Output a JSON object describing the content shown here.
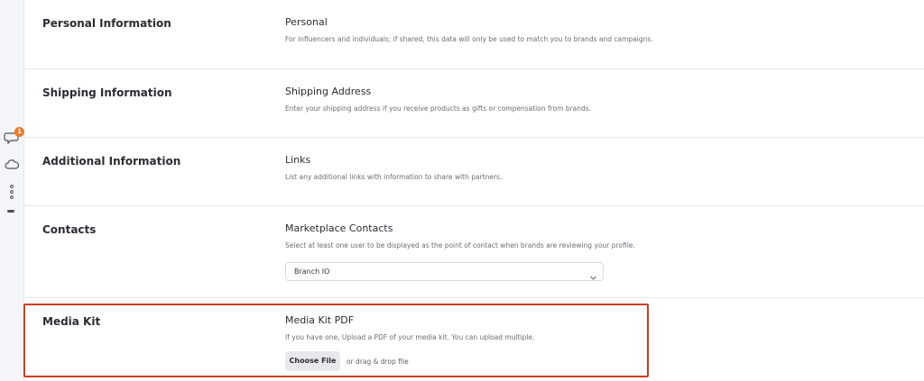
{
  "rail": {
    "icons": [
      "chat-bubble-icon",
      "cloud-icon",
      "more-dots-icon"
    ],
    "notification_count": "1",
    "badge_color": "#e87a2a"
  },
  "sections": [
    {
      "title": "Personal Information",
      "field_title": "Personal",
      "description": "For influencers and individuals; if shared, this data will only be used to match you to brands and campaigns."
    },
    {
      "title": "Shipping Information",
      "field_title": "Shipping Address",
      "description": "Enter your shipping address if you receive products as gifts or compensation from brands."
    },
    {
      "title": "Additional Information",
      "field_title": "Links",
      "description": "List any additional links with information to share with partners."
    },
    {
      "title": "Contacts",
      "field_title": "Marketplace Contacts",
      "description": "Select at least one user to be displayed as the point of contact when brands are reviewing your profile.",
      "select_value": "Branch IO",
      "select_icon": "chevron-down-icon"
    },
    {
      "title": "Media Kit",
      "field_title": "Media Kit PDF",
      "description": "If you have one, Upload a PDF of your media kit. You can upload multiple.",
      "button_label": "Choose File",
      "drop_text": "or drag & drop file"
    }
  ],
  "highlight_color": "#c7401f"
}
